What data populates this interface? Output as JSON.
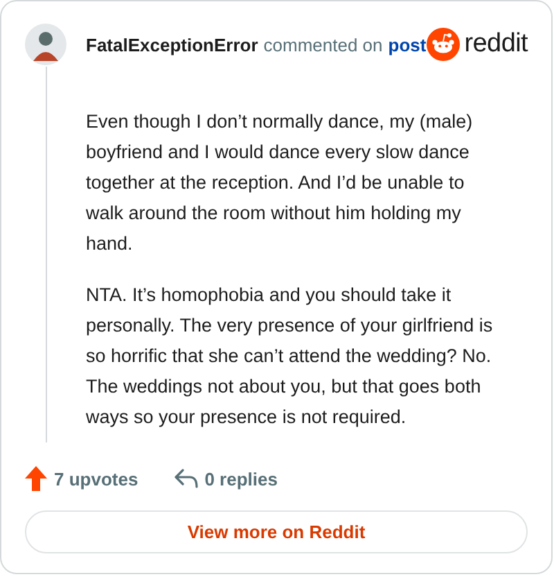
{
  "comment": {
    "author": "FatalExceptionError",
    "action": "commented on",
    "link": "post",
    "paragraphs": [
      "Even though I don’t normally dance, my (male) boyfriend and I would dance every slow dance together at the reception. And I’d be unable to walk around the room without him holding my hand.",
      "NTA. It’s homophobia and you should take it personally. The very presence of your girlfriend is so horrific that she can’t attend the wedding? No. The weddings not about you, but that goes both ways so your presence is not required."
    ]
  },
  "brand": {
    "name": "reddit"
  },
  "stats": {
    "upvotes": "7 upvotes",
    "replies": "0 replies"
  },
  "button": "View more on Reddit"
}
